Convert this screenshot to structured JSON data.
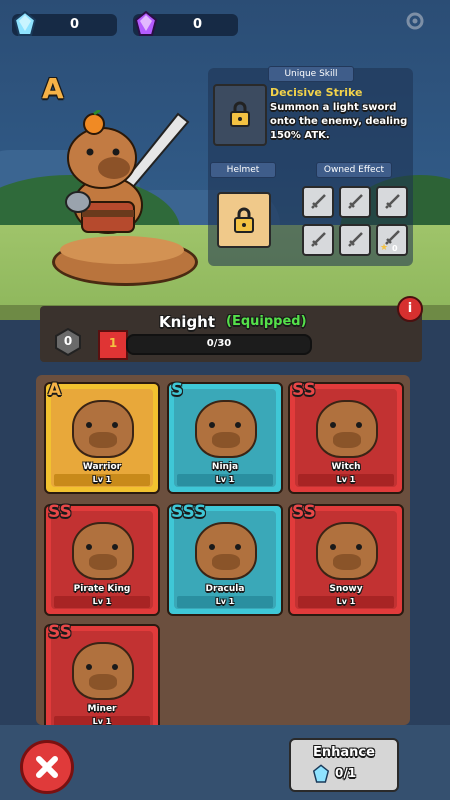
{
  "currency": {
    "crystal_blue": "0",
    "crystal_purple": "0"
  },
  "hero": {
    "rank": "A",
    "name": "Knight",
    "equipped_label": "(Equipped)",
    "level_badge": "0",
    "shard_level": "1",
    "progress_text": "0/30",
    "progress_fraction": 0.0
  },
  "skill": {
    "unique_skill_tag": "Unique Skill",
    "title": "Decisive Strike",
    "description": "Summon a light sword onto the enemy, dealing 150% ATK.",
    "helmet_tag": "Helmet",
    "owned_effect_tag": "Owned Effect",
    "star_count": "0"
  },
  "cards": [
    {
      "rank": "A",
      "name": "Warrior",
      "level": "Lv 1",
      "style": "gold"
    },
    {
      "rank": "S",
      "name": "Ninja",
      "level": "Lv 1",
      "style": "cyan"
    },
    {
      "rank": "SS",
      "name": "Witch",
      "level": "Lv 1",
      "style": "red"
    },
    {
      "rank": "SS",
      "name": "Pirate King",
      "level": "Lv 1",
      "style": "red"
    },
    {
      "rank": "SSS",
      "name": "Dracula",
      "level": "Lv 1",
      "style": "cyan"
    },
    {
      "rank": "SS",
      "name": "Snowy",
      "level": "Lv 1",
      "style": "red"
    },
    {
      "rank": "SS",
      "name": "Miner",
      "level": "Lv 1",
      "style": "red"
    }
  ],
  "enhance": {
    "label": "Enhance",
    "cost": "0/1"
  },
  "colors": {
    "gold": "#f2c230",
    "cyan": "#3fc7d6",
    "red": "#e13b3b",
    "equipped_green": "#55e04a"
  }
}
